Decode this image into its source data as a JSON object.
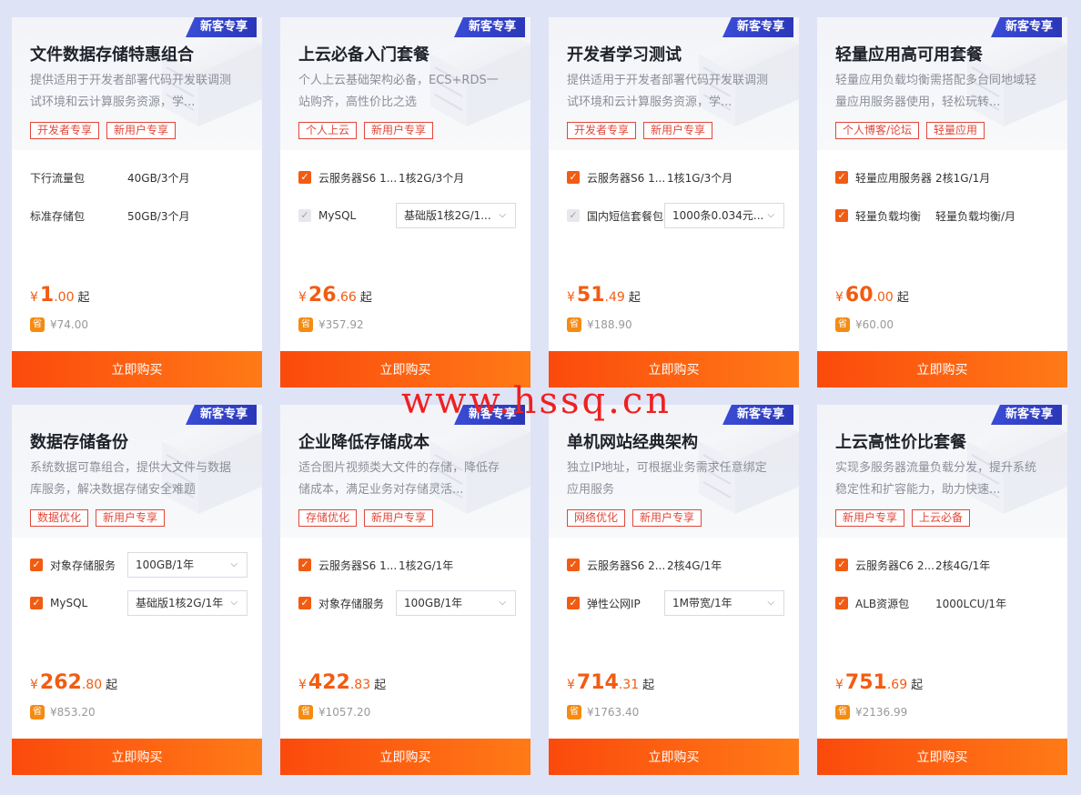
{
  "badge": "新客专享",
  "buy_label": "立即购买",
  "from_label": "起",
  "currency": "¥",
  "save_glyph": "省",
  "watermark": "www.hssq.cn",
  "cards": [
    {
      "title": "文件数据存储特惠组合",
      "desc": "提供适用于开发者部署代码开发联调测试环境和云计算服务资源，学...",
      "tags": [
        "开发者专享",
        "新用户专享"
      ],
      "rows": [
        {
          "label": "下行流量包",
          "value": "40GB/3个月"
        },
        {
          "label": "标准存储包",
          "value": "50GB/3个月"
        }
      ],
      "price_int": "1",
      "price_dec": ".00",
      "orig": "¥74.00"
    },
    {
      "title": "上云必备入门套餐",
      "desc": "个人上云基础架构必备，ECS+RDS一站购齐，高性价比之选",
      "tags": [
        "个人上云",
        "新用户专享"
      ],
      "rows": [
        {
          "label": "云服务器S6 1...",
          "value": "1核2G/3个月"
        },
        {
          "label": "MySQL",
          "select": "基础版1核2G/1..."
        }
      ],
      "price_int": "26",
      "price_dec": ".66",
      "orig": "¥357.92"
    },
    {
      "title": "开发者学习测试",
      "desc": "提供适用于开发者部署代码开发联调测试环境和云计算服务资源，学...",
      "tags": [
        "开发者专享",
        "新用户专享"
      ],
      "rows": [
        {
          "label": "云服务器S6 1...",
          "value": "1核1G/3个月"
        },
        {
          "label": "国内短信套餐包",
          "select": "1000条0.034元..."
        }
      ],
      "price_int": "51",
      "price_dec": ".49",
      "orig": "¥188.90"
    },
    {
      "title": "轻量应用高可用套餐",
      "desc": "轻量应用负载均衡需搭配多台同地域轻量应用服务器使用，轻松玩转...",
      "tags": [
        "个人博客/论坛",
        "轻量应用"
      ],
      "rows": [
        {
          "label": "轻量应用服务器",
          "value": "2核1G/1月"
        },
        {
          "label": "轻量负载均衡",
          "value": "轻量负载均衡/月"
        }
      ],
      "price_int": "60",
      "price_dec": ".00",
      "orig": "¥60.00"
    },
    {
      "title": "数据存储备份",
      "desc": "系统数据可靠组合，提供大文件与数据库服务，解决数据存储安全难题",
      "tags": [
        "数据优化",
        "新用户专享"
      ],
      "rows": [
        {
          "label": "对象存储服务",
          "select": "100GB/1年"
        },
        {
          "label": "MySQL",
          "select": "基础版1核2G/1年"
        }
      ],
      "price_int": "262",
      "price_dec": ".80",
      "orig": "¥853.20"
    },
    {
      "title": "企业降低存储成本",
      "desc": "适合图片视频类大文件的存储，降低存储成本，满足业务对存储灵活...",
      "tags": [
        "存储优化",
        "新用户专享"
      ],
      "rows": [
        {
          "label": "云服务器S6 1...",
          "value": "1核2G/1年"
        },
        {
          "label": "对象存储服务",
          "select": "100GB/1年"
        }
      ],
      "price_int": "422",
      "price_dec": ".83",
      "orig": "¥1057.20"
    },
    {
      "title": "单机网站经典架构",
      "desc": "独立IP地址，可根据业务需求任意绑定应用服务",
      "tags": [
        "网络优化",
        "新用户专享"
      ],
      "rows": [
        {
          "label": "云服务器S6 2...",
          "value": "2核4G/1年"
        },
        {
          "label": "弹性公网IP",
          "select": "1M带宽/1年"
        }
      ],
      "price_int": "714",
      "price_dec": ".31",
      "orig": "¥1763.40"
    },
    {
      "title": "上云高性价比套餐",
      "desc": "实现多服务器流量负载分发，提升系统稳定性和扩容能力，助力快速...",
      "tags": [
        "新用户专享",
        "上云必备"
      ],
      "rows": [
        {
          "label": "云服务器C6 2...",
          "value": "2核4G/1年"
        },
        {
          "label": "ALB资源包",
          "value": "1000LCU/1年"
        }
      ],
      "price_int": "751",
      "price_dec": ".69",
      "orig": "¥2136.99"
    }
  ]
}
